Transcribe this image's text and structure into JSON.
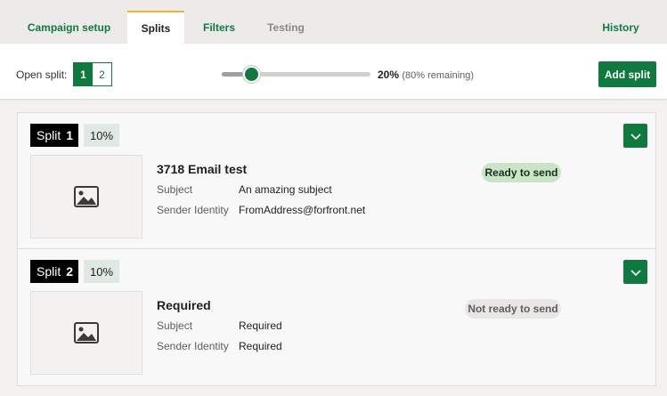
{
  "tabs": [
    {
      "label": "Campaign setup"
    },
    {
      "label": "Splits"
    },
    {
      "label": "Filters"
    },
    {
      "label": "Testing"
    },
    {
      "label": "History"
    }
  ],
  "toolbar": {
    "open_split_label": "Open split:",
    "split_options": [
      "1",
      "2"
    ],
    "selected_split": "1",
    "slider_value_percent": 20,
    "percent_text": "20%",
    "remaining_text": "(80% remaining)",
    "add_split_label": "Add split"
  },
  "splits": [
    {
      "label": "Split",
      "number": "1",
      "percent": "10%",
      "title": "3718 Email test",
      "subject_label": "Subject",
      "subject": "An amazing subject",
      "sender_label": "Sender Identity",
      "sender": "FromAddress@forfront.net",
      "status": "Ready to send"
    },
    {
      "label": "Split",
      "number": "2",
      "percent": "10%",
      "title": "Required",
      "subject_label": "Subject",
      "subject": "Required",
      "sender_label": "Sender Identity",
      "sender": "Required",
      "status": "Not ready to send"
    }
  ],
  "colors": {
    "accent": "#0e7a3e",
    "tab_indicator": "#f0b429",
    "ready_bg": "#c9e4c6",
    "not_ready_bg": "#e8e7e6"
  }
}
